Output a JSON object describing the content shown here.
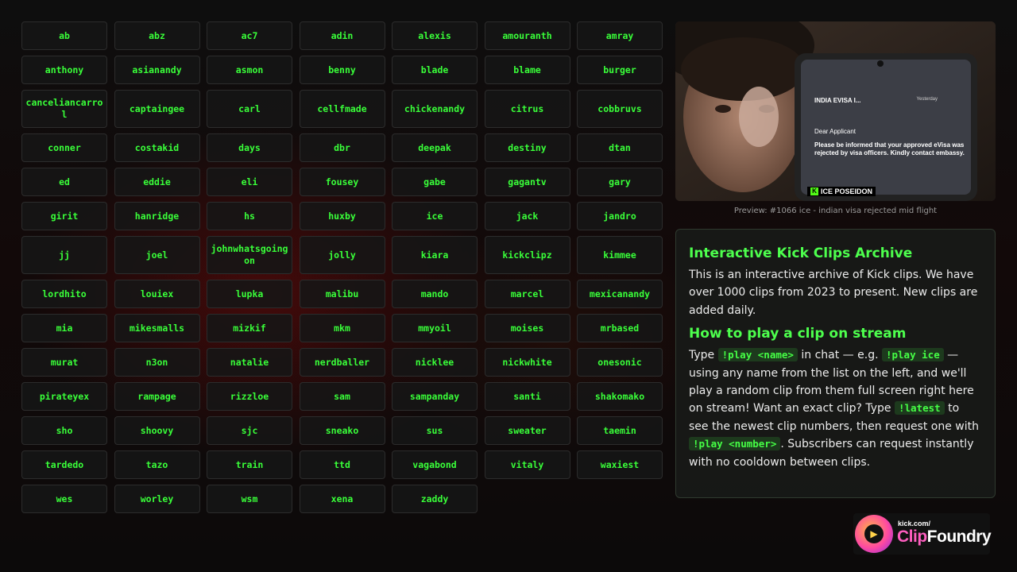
{
  "names": [
    "ab",
    "abz",
    "ac7",
    "adin",
    "alexis",
    "amouranth",
    "amray",
    "anthony",
    "asianandy",
    "asmon",
    "benny",
    "blade",
    "blame",
    "burger",
    "canceliancarrol",
    "captaingee",
    "carl",
    "cellfmade",
    "chickenandy",
    "citrus",
    "cobbruvs",
    "conner",
    "costakid",
    "days",
    "dbr",
    "deepak",
    "destiny",
    "dtan",
    "ed",
    "eddie",
    "eli",
    "fousey",
    "gabe",
    "gagantv",
    "gary",
    "girit",
    "hanridge",
    "hs",
    "huxby",
    "ice",
    "jack",
    "jandro",
    "jj",
    "joel",
    "johnwhatsgoingon",
    "jolly",
    "kiara",
    "kickclipz",
    "kimmee",
    "lordhito",
    "louiex",
    "lupka",
    "malibu",
    "mando",
    "marcel",
    "mexicanandy",
    "mia",
    "mikesmalls",
    "mizkif",
    "mkm",
    "mmyoil",
    "moises",
    "mrbased",
    "murat",
    "n3on",
    "natalie",
    "nerdballer",
    "nicklee",
    "nickwhite",
    "onesonic",
    "pirateyex",
    "rampage",
    "rizzloe",
    "sam",
    "sampanday",
    "santi",
    "shakomako",
    "sho",
    "shoovy",
    "sjc",
    "sneako",
    "sus",
    "sweater",
    "taemin",
    "tardedo",
    "tazo",
    "train",
    "ttd",
    "vagabond",
    "vitaly",
    "waxiest",
    "wes",
    "worley",
    "wsm",
    "xena",
    "zaddy"
  ],
  "preview": {
    "caption": "Preview: #1066 ice - indian visa rejected mid flight",
    "overlay": {
      "badge": "ICE POSEIDON",
      "phone_sender": "INDIA EVISA I...",
      "phone_time": "Yesterday",
      "phone_greeting": "Dear Applicant",
      "phone_body": "Please be informed that your approved eVisa was rejected by visa officers. Kindly contact embassy."
    }
  },
  "info": {
    "title": "Interactive Kick Clips Archive",
    "description": "This is an interactive archive of Kick clips. We have over 1000 clips from 2023 to present. New clips are added daily.",
    "howto_title": "How to play a clip on stream",
    "type_label": "Type",
    "cmd_play_name": "!play <name>",
    "in_chat": "in chat — e.g.",
    "cmd_play_ice": "!play ice",
    "dash": "—",
    "middle": "using any name from the list on the left, and we'll play a random clip from them full screen right here on stream! Want an exact clip? Type",
    "cmd_latest": "!latest",
    "middle2": "to see the newest clip numbers, then request one with",
    "cmd_play_number": "!play <number>",
    "end": ". Subscribers can request instantly with no cooldown between clips."
  },
  "logo": {
    "small": "kick.com/",
    "clip": "Clip",
    "foundry": "Foundry"
  }
}
